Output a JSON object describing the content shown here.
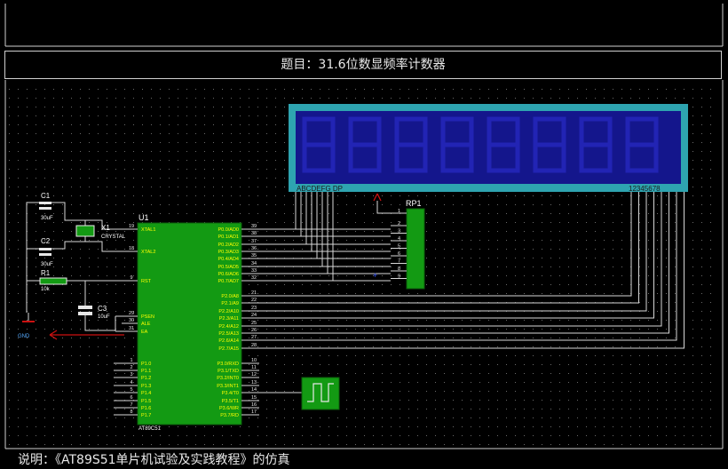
{
  "header": {
    "title": "题目：31.6位数显频率计数器"
  },
  "footer": {
    "caption": "说明：《AT89S51单片机试验及实践教程》的仿真"
  },
  "colors": {
    "background": "#000000",
    "wire": "#d8d8d8",
    "chip_fill": "#139a13",
    "chip_text": "#ffff00",
    "lcd_frame": "#2ea4b0",
    "lcd_screen": "#14168c",
    "label": "#ffffff",
    "probe": "#cc1111"
  },
  "mcu": {
    "ref": "U1",
    "part": "AT89C51",
    "left_pins": [
      {
        "num": "19",
        "name": "XTAL1"
      },
      {
        "num": "18",
        "name": "XTAL2"
      },
      {
        "num": "9",
        "name": "RST"
      },
      {
        "num": "29",
        "name": "PSEN"
      },
      {
        "num": "30",
        "name": "ALE"
      },
      {
        "num": "31",
        "name": "EA"
      },
      {
        "num": "1",
        "name": "P1.0"
      },
      {
        "num": "2",
        "name": "P1.1"
      },
      {
        "num": "3",
        "name": "P1.2"
      },
      {
        "num": "4",
        "name": "P1.3"
      },
      {
        "num": "5",
        "name": "P1.4"
      },
      {
        "num": "6",
        "name": "P1.5"
      },
      {
        "num": "7",
        "name": "P1.6"
      },
      {
        "num": "8",
        "name": "P1.7"
      }
    ],
    "right_pins": [
      {
        "num": "39",
        "name": "P0.0/AD0"
      },
      {
        "num": "38",
        "name": "P0.1/AD1"
      },
      {
        "num": "37",
        "name": "P0.2/AD2"
      },
      {
        "num": "36",
        "name": "P0.3/AD3"
      },
      {
        "num": "35",
        "name": "P0.4/AD4"
      },
      {
        "num": "34",
        "name": "P0.5/AD5"
      },
      {
        "num": "33",
        "name": "P0.6/AD6"
      },
      {
        "num": "32",
        "name": "P0.7/AD7"
      },
      {
        "num": "21",
        "name": "P2.0/A8"
      },
      {
        "num": "22",
        "name": "P2.1/A9"
      },
      {
        "num": "23",
        "name": "P2.2/A10"
      },
      {
        "num": "24",
        "name": "P2.3/A11"
      },
      {
        "num": "25",
        "name": "P2.4/A12"
      },
      {
        "num": "26",
        "name": "P2.5/A13"
      },
      {
        "num": "27",
        "name": "P2.6/A14"
      },
      {
        "num": "28",
        "name": "P2.7/A15"
      },
      {
        "num": "10",
        "name": "P3.0/RXD"
      },
      {
        "num": "11",
        "name": "P3.1/TXD"
      },
      {
        "num": "12",
        "name": "P3.2/INT0"
      },
      {
        "num": "13",
        "name": "P3.3/INT1"
      },
      {
        "num": "14",
        "name": "P3.4/T0"
      },
      {
        "num": "15",
        "name": "P3.5/T1"
      },
      {
        "num": "16",
        "name": "P3.6/WR"
      },
      {
        "num": "17",
        "name": "P3.7/RD"
      }
    ]
  },
  "components": {
    "c1": {
      "ref": "C1",
      "value": "30uF"
    },
    "c2": {
      "ref": "C2",
      "value": "30uF"
    },
    "c3": {
      "ref": "C3",
      "value": "10uF"
    },
    "r1": {
      "ref": "R1",
      "value": "10k"
    },
    "x1": {
      "ref": "X1",
      "value": "CRYSTAL"
    },
    "rp1": {
      "ref": "RP1",
      "pins": [
        "1",
        "2",
        "3",
        "4",
        "5",
        "6",
        "7",
        "8",
        "9"
      ]
    },
    "gnd": {
      "label": "GND"
    }
  },
  "display": {
    "digit_count": 8,
    "segment_label": "ABCDEFG DP",
    "digit_label": "12345678"
  }
}
